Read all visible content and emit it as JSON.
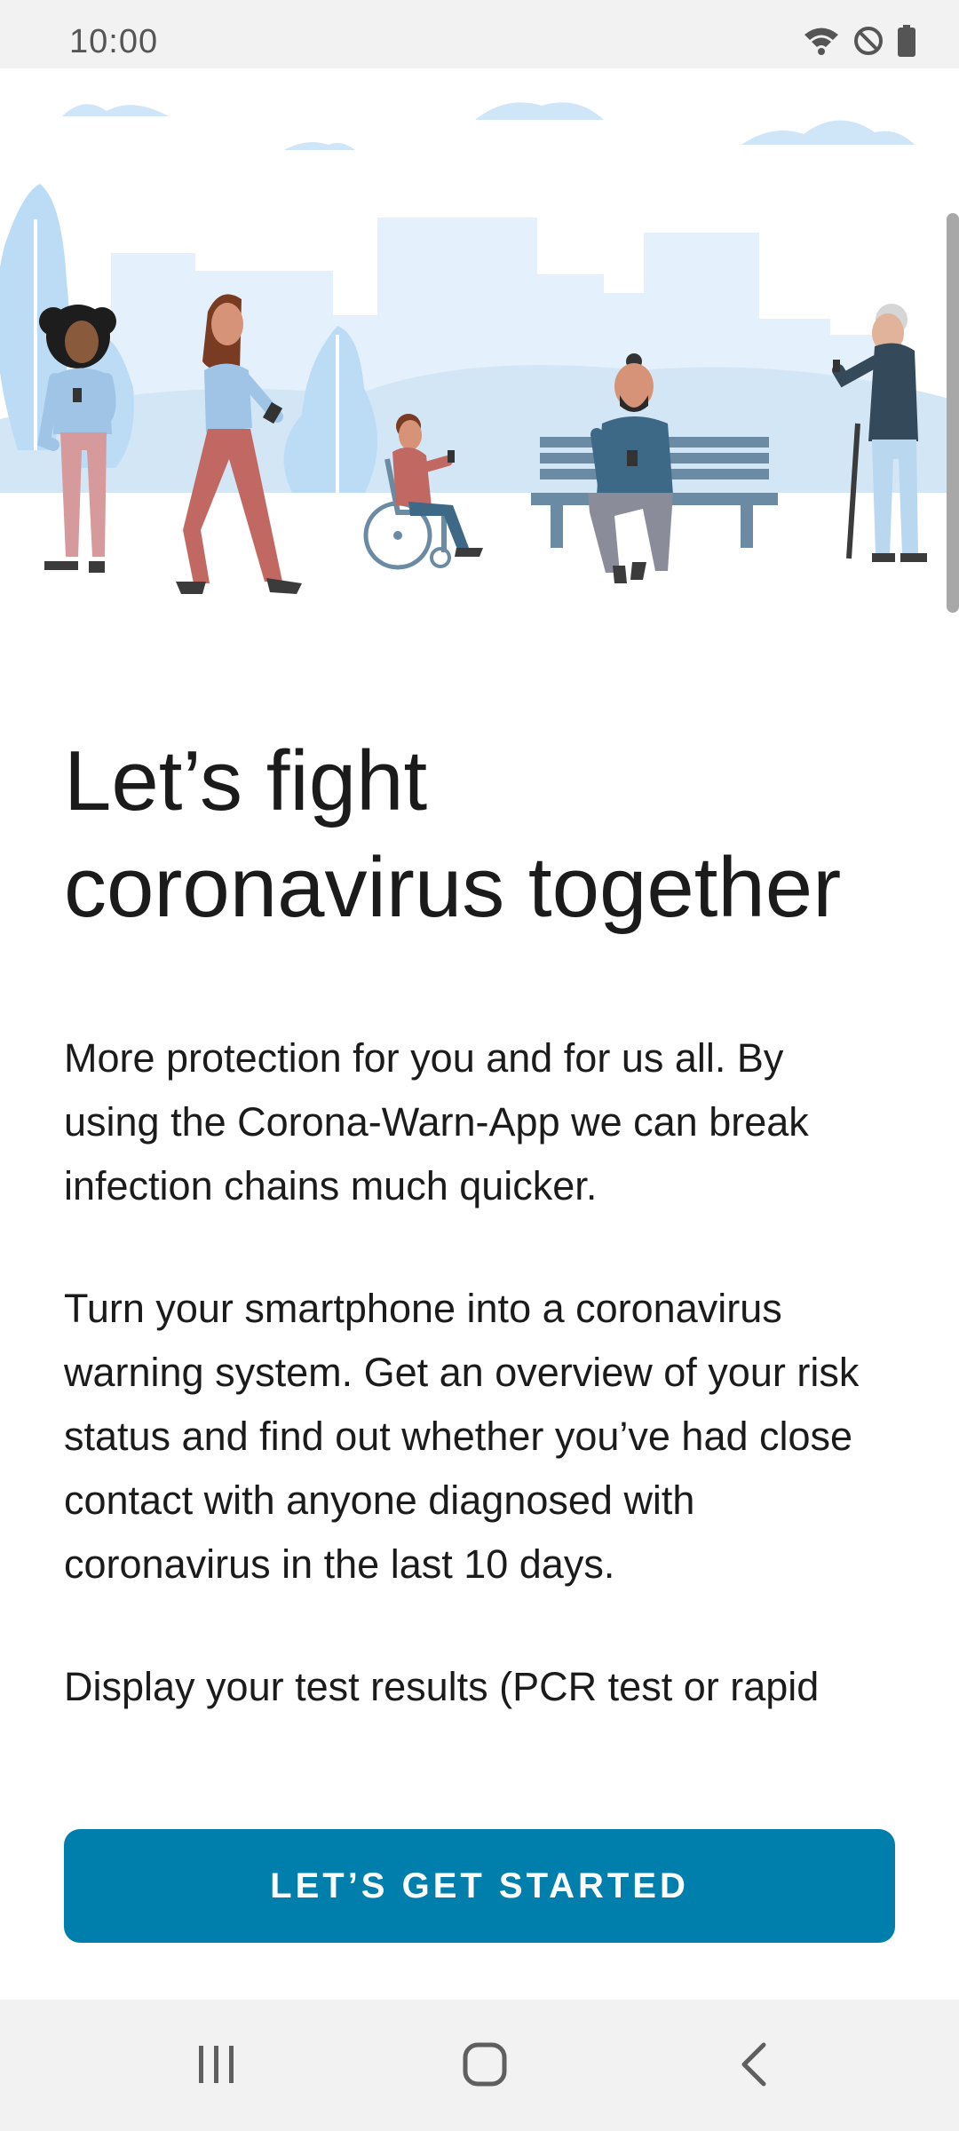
{
  "status_bar": {
    "time": "10:00",
    "icons": [
      "wifi-icon",
      "do-not-disturb-icon",
      "battery-icon"
    ]
  },
  "hero": {
    "illustration": "people-in-park-with-smartphones",
    "colors": {
      "sky_shape": "#e4f1fc",
      "tree": "#bcdcf6",
      "bench": "#6b8aa3",
      "ground_hill": "#d3e6f6"
    }
  },
  "onboarding": {
    "headline": "Let’s fight coronavirus together",
    "paragraphs": [
      "More protection for you and for us all. By using the Corona-Warn-App we can break infection chains much quicker.",
      "Turn your smartphone into a coronavirus warning system. Get an overview of your risk status and find out whether you’ve had close contact with anyone diagnosed with coronavirus in the last 10 days.",
      "Display your test results (PCR test or rapid"
    ]
  },
  "cta": {
    "label": "LET’S GET STARTED",
    "color": "#007fad"
  },
  "nav_bar": {
    "buttons": [
      "recent-apps-icon",
      "home-icon",
      "back-icon"
    ]
  }
}
